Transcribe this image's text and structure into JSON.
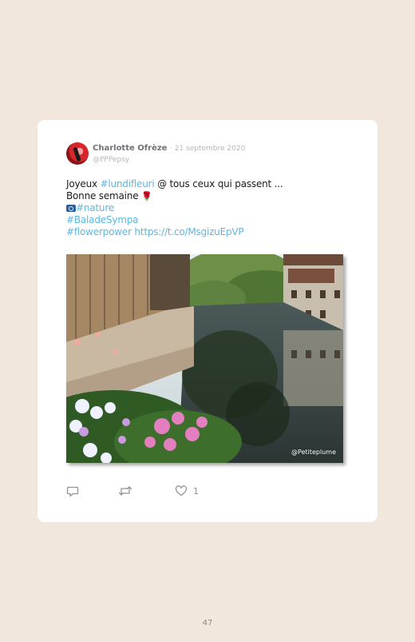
{
  "tweet": {
    "author_name": "Charlotte Ofrèze",
    "separator": "·",
    "date": "21 septembre 2020",
    "handle": "@PPPepsy",
    "line1_prefix": "Joyeux ",
    "line1_hashtag": "#lundifleuri",
    "line1_suffix": " @ tous ceux qui passent ...",
    "line2_text": "Bonne semaine ",
    "line2_emoji": "🌹",
    "line3_hashtag": "#nature",
    "line4_hashtag": "#BaladeSympa",
    "line5_hashtag": "#flowerpower",
    "line5_link": "https://t.co/MsgizuEpVP",
    "photo_watermark": "@Petiteplume",
    "like_count": "1",
    "icons": [
      "avatar",
      "camera-icon",
      "reply-icon",
      "retweet-icon",
      "like-icon"
    ]
  },
  "page": {
    "number": "47",
    "background_color": "#f2e7dc",
    "card_color": "#ffffff",
    "link_color": "#5bb7e3"
  }
}
